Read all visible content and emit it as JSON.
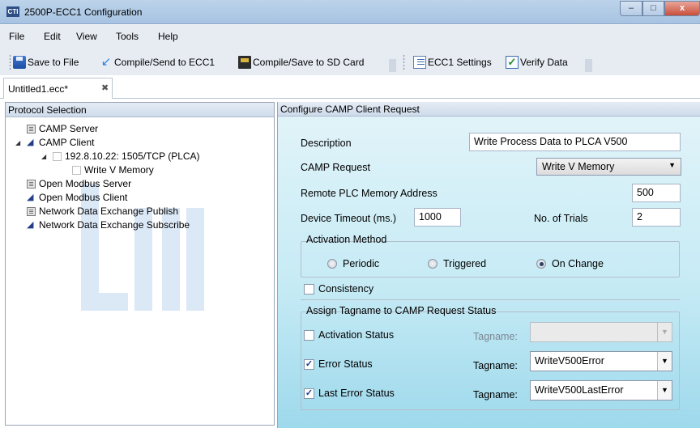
{
  "window": {
    "title": "2500P-ECC1 Configuration",
    "app_icon_text": "CTI",
    "min_glyph": "–",
    "max_glyph": "□",
    "close_glyph": "x"
  },
  "menu": {
    "items": [
      "File",
      "Edit",
      "View",
      "Tools",
      "Help"
    ]
  },
  "toolbar": {
    "save_to_file": "Save to File",
    "compile_send": "Compile/Send to ECC1",
    "compile_save_sd": "Compile/Save to SD Card",
    "ecc1_settings": "ECC1 Settings",
    "verify_data": "Verify Data"
  },
  "tabs": [
    {
      "label": "Untitled1.ecc*",
      "close_glyph": "✖"
    }
  ],
  "protocol_selection": {
    "header": "Protocol Selection",
    "tree": [
      {
        "label": "CAMP Server",
        "icon": "server-icon"
      },
      {
        "label": "CAMP Client",
        "icon": "client-icon",
        "expanded": true
      },
      {
        "label": "192.8.10.22: 1505/TCP (PLCA)",
        "icon": "document-icon",
        "expanded": true
      },
      {
        "label": "Write V Memory",
        "icon": "document-icon",
        "selected": true
      },
      {
        "label": "Open Modbus Server",
        "icon": "server-icon"
      },
      {
        "label": "Open Modbus Client",
        "icon": "client-icon"
      },
      {
        "label": "Network Data Exchange Publish",
        "icon": "server-icon"
      },
      {
        "label": "Network Data Exchange Subscribe",
        "icon": "client-icon"
      }
    ]
  },
  "config": {
    "header": "Configure CAMP Client Request",
    "description_label": "Description",
    "description_value": "Write Process Data to PLCA V500",
    "camp_request_label": "CAMP Request",
    "camp_request_value": "Write V Memory",
    "remote_address_label": "Remote PLC Memory Address",
    "remote_address_value": "500",
    "device_timeout_label": "Device Timeout (ms.)",
    "device_timeout_value": "1000",
    "trials_label": "No. of Trials",
    "trials_value": "2",
    "activation": {
      "title": "Activation Method",
      "options": [
        "Periodic",
        "Triggered",
        "On Change"
      ],
      "selected": "On Change"
    },
    "consistency_label": "Consistency",
    "consistency_checked": false,
    "status": {
      "title": "Assign Tagname to CAMP Request Status",
      "tagname_label": "Tagname:",
      "rows": [
        {
          "label": "Activation Status",
          "checked": false,
          "tagname": "",
          "enabled": false
        },
        {
          "label": "Error Status",
          "checked": true,
          "tagname": "WriteV500Error",
          "enabled": true
        },
        {
          "label": "Last Error Status",
          "checked": true,
          "tagname": "WriteV500LastError",
          "enabled": true
        }
      ]
    }
  },
  "colors": {
    "panel_gradient_top": "#e3f4f9",
    "panel_gradient_bottom": "#9ed9ec",
    "watermark": "#dbe8f6"
  }
}
